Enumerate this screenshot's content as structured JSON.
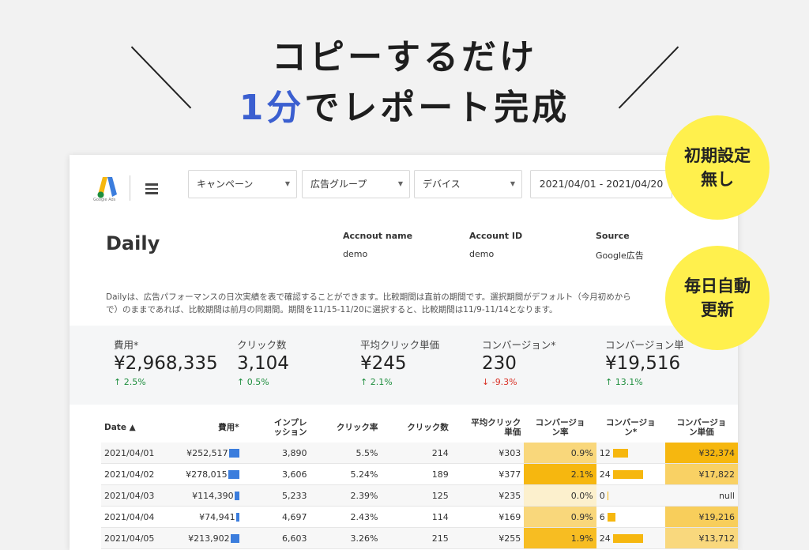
{
  "headline": {
    "line1": "コピーするだけ",
    "line2_accent": "1分",
    "line2_rest": "でレポート完成"
  },
  "badges": [
    {
      "line1": "初期設定",
      "line2": "無し"
    },
    {
      "line1": "毎日自動",
      "line2": "更新"
    }
  ],
  "toolbar": {
    "logo_caption": "Google Ads",
    "filters": [
      "キャンペーン",
      "広告グループ",
      "デバイス"
    ],
    "date_range": "2021/04/01 - 2021/04/20"
  },
  "report": {
    "title": "Daily",
    "meta": [
      {
        "label": "Accnout name",
        "value": "demo"
      },
      {
        "label": "Account ID",
        "value": "demo"
      },
      {
        "label": "Source",
        "value": "Google広告"
      }
    ],
    "description_line1": "Dailyは、広告パフォーマンスの日次実績を表で確認することができます。比較期間は直前の期間です。選択期間がデフォルト（今月初めから",
    "description_line2": "で）のままであれば、比較期間は前月の同期間。期間を11/15-11/20に選択すると、比較期間は11/9-11/14となります。"
  },
  "kpis": [
    {
      "label": "費用*",
      "value": "¥2,968,335",
      "change": "2.5%",
      "direction": "up"
    },
    {
      "label": "クリック数",
      "value": "3,104",
      "change": "0.5%",
      "direction": "up"
    },
    {
      "label": "平均クリック単価",
      "value": "¥245",
      "change": "2.1%",
      "direction": "up"
    },
    {
      "label": "コンバージョン*",
      "value": "230",
      "change": "-9.3%",
      "direction": "down"
    },
    {
      "label": "コンバージョン単",
      "value": "¥19,516",
      "change": "13.1%",
      "direction": "up"
    }
  ],
  "table": {
    "headers": [
      "Date ▲",
      "費用*",
      "インプレ\nッション",
      "クリック率",
      "クリック数",
      "平均クリック\n単価",
      "コンバージョ\nン率",
      "コンバージョ\nン*",
      "コンバージョ\nン単価"
    ],
    "rows": [
      {
        "date": "2021/04/01",
        "cost": "¥252,517",
        "cost_frac": 0.91,
        "impr": "3,890",
        "ctr": "5.5%",
        "clicks": "214",
        "cpc": "¥303",
        "cvr": "0.9%",
        "cvr_level": 0.43,
        "conv": "12",
        "conv_frac": 0.5,
        "cpa": "¥32,374",
        "cpa_level": 1.0
      },
      {
        "date": "2021/04/02",
        "cost": "¥278,015",
        "cost_frac": 1.0,
        "impr": "3,606",
        "ctr": "5.24%",
        "clicks": "189",
        "cpc": "¥377",
        "cvr": "2.1%",
        "cvr_level": 1.0,
        "conv": "24",
        "conv_frac": 1.0,
        "cpa": "¥17,822",
        "cpa_level": 0.55
      },
      {
        "date": "2021/04/03",
        "cost": "¥114,390",
        "cost_frac": 0.41,
        "impr": "5,233",
        "ctr": "2.39%",
        "clicks": "125",
        "cpc": "¥235",
        "cvr": "0.0%",
        "cvr_level": 0.0,
        "conv": "0",
        "conv_frac": 0.0,
        "cpa": "null",
        "cpa_level": 0.0
      },
      {
        "date": "2021/04/04",
        "cost": "¥74,941",
        "cost_frac": 0.27,
        "impr": "4,697",
        "ctr": "2.43%",
        "clicks": "114",
        "cpc": "¥169",
        "cvr": "0.9%",
        "cvr_level": 0.43,
        "conv": "6",
        "conv_frac": 0.25,
        "cpa": "¥19,216",
        "cpa_level": 0.6
      },
      {
        "date": "2021/04/05",
        "cost": "¥213,902",
        "cost_frac": 0.77,
        "impr": "6,603",
        "ctr": "3.26%",
        "clicks": "215",
        "cpc": "¥255",
        "cvr": "1.9%",
        "cvr_level": 0.9,
        "conv": "24",
        "conv_frac": 1.0,
        "cpa": "¥13,712",
        "cpa_level": 0.42
      }
    ]
  },
  "colors": {
    "accent": "#3b5fd0",
    "badge": "#fff04d",
    "bar_blue": "#3b7ddd",
    "bar_yellow": "#f6b70f",
    "up": "#1e8e3e",
    "down": "#d93025"
  }
}
